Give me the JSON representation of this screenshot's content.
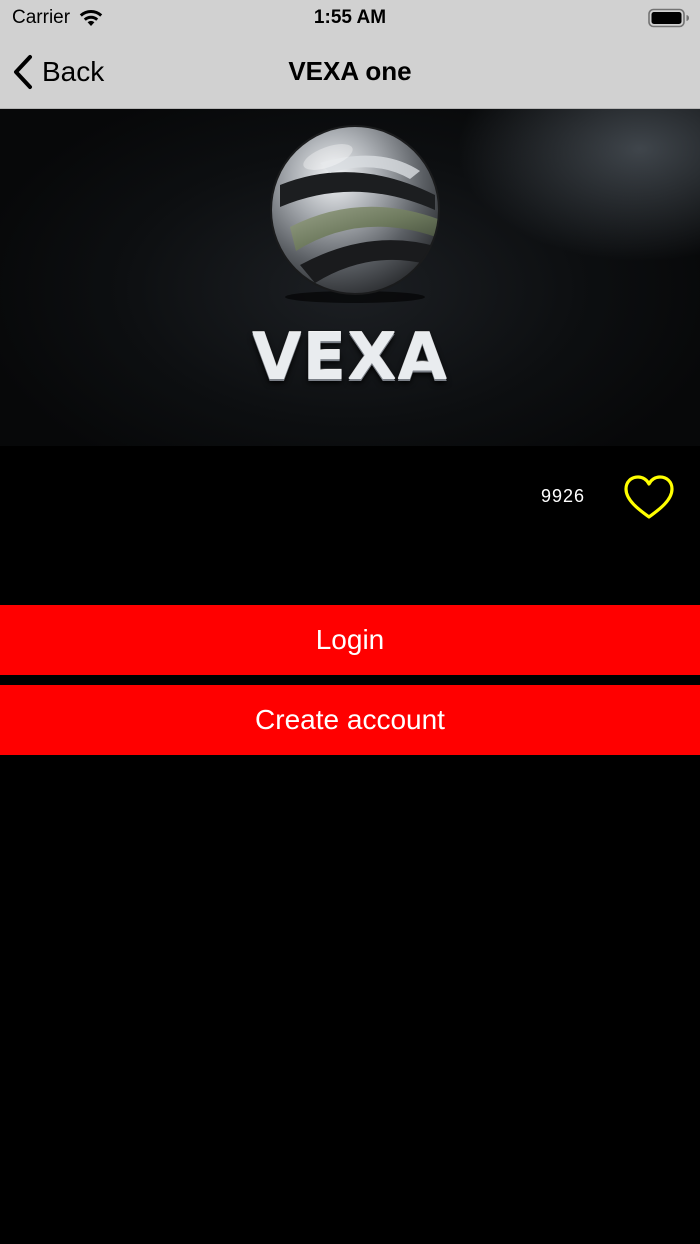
{
  "status_bar": {
    "carrier": "Carrier",
    "time": "1:55 AM"
  },
  "nav": {
    "back_label": "Back",
    "title": "VEXA one"
  },
  "hero": {
    "brand": "VEXA"
  },
  "likes": {
    "count": "9926",
    "icon": "heart-outline-icon",
    "color": "#FFFF00"
  },
  "actions": {
    "login_label": "Login",
    "create_account_label": "Create account",
    "button_color": "#FF0000"
  },
  "colors": {
    "bar_background": "#D1D1D1",
    "page_background": "#000000"
  }
}
